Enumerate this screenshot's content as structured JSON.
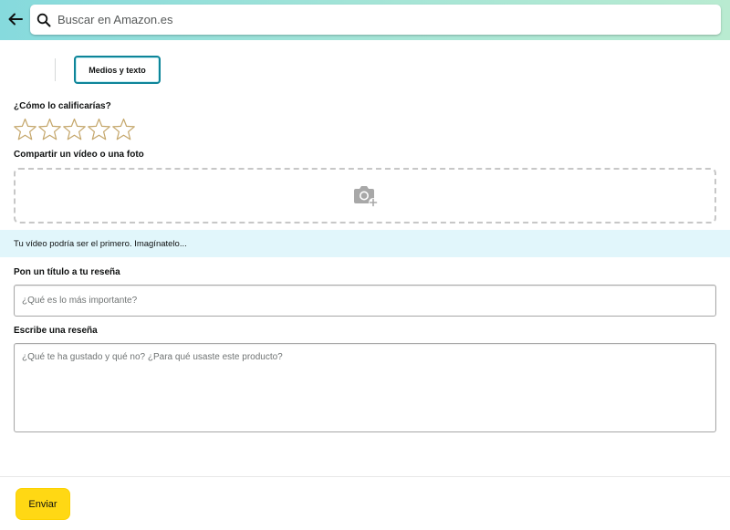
{
  "header": {
    "search_placeholder": "Buscar en Amazon.es",
    "back_icon": "arrow-left-icon",
    "search_icon": "magnifier-icon"
  },
  "tabs": [
    {
      "label": "Medios y texto",
      "selected": true
    }
  ],
  "rating": {
    "label": "¿Cómo lo calificarías?",
    "max_stars": 5,
    "selected_stars": 0,
    "star_color": "#c4a66a"
  },
  "media": {
    "label": "Compartir un vídeo o una foto",
    "icon": "camera-add-icon"
  },
  "banner": {
    "text": "Tu vídeo podría ser el primero. Imagínatelo..."
  },
  "title_field": {
    "label": "Pon un título a tu reseña",
    "placeholder": "¿Qué es lo más importante?",
    "value": ""
  },
  "review_field": {
    "label": "Escribe una reseña",
    "placeholder": "¿Qué te ha gustado y qué no? ¿Para qué usaste este producto?",
    "value": ""
  },
  "footer": {
    "submit_label": "Enviar"
  },
  "colors": {
    "accent_teal": "#0e8599",
    "button_yellow": "#ffd814",
    "banner_bg": "#e1f6fb"
  }
}
